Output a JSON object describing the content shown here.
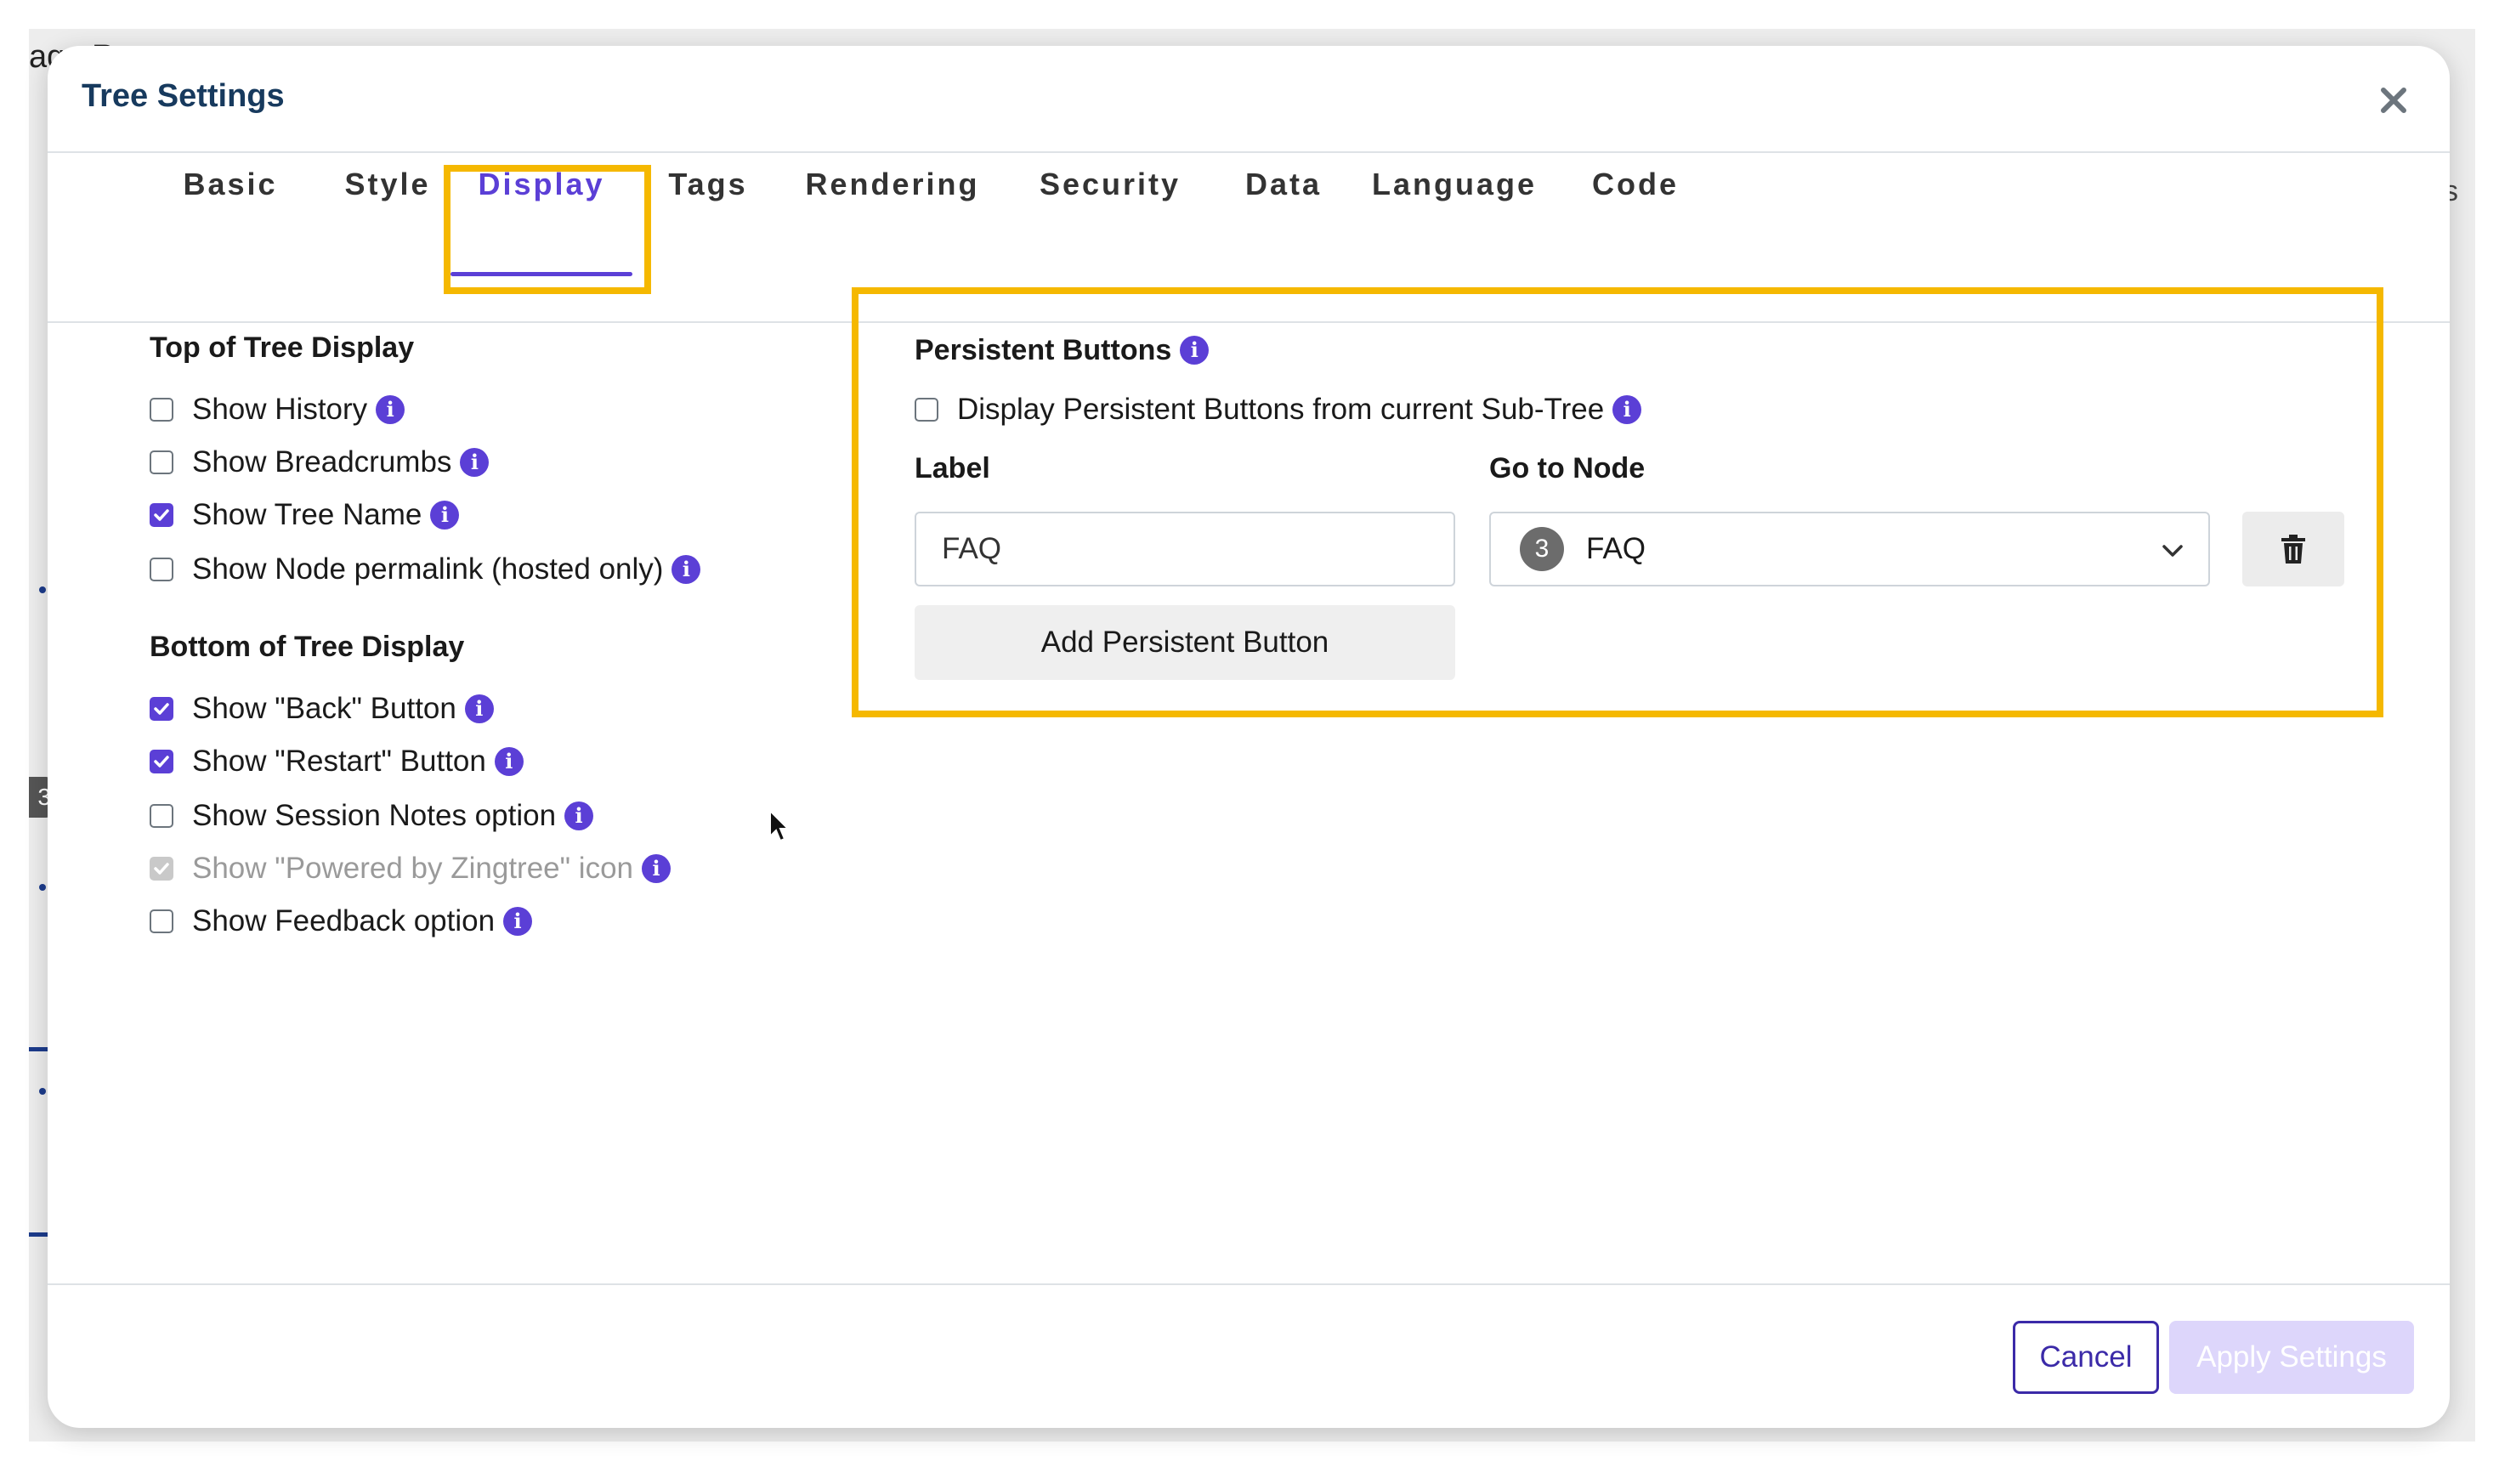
{
  "background": {
    "title": "age Reports",
    "edge_text": "s",
    "badge": "3"
  },
  "modal": {
    "title": "Tree Settings",
    "close_label": "×"
  },
  "tabs": [
    {
      "label": "Basic"
    },
    {
      "label": "Style"
    },
    {
      "label": "Display"
    },
    {
      "label": "Tags"
    },
    {
      "label": "Rendering"
    },
    {
      "label": "Security"
    },
    {
      "label": "Data"
    },
    {
      "label": "Language"
    },
    {
      "label": "Code"
    }
  ],
  "active_tab": "Display",
  "top_display": {
    "title": "Top of Tree Display",
    "options": [
      {
        "label": "Show History",
        "checked": false
      },
      {
        "label": "Show Breadcrumbs",
        "checked": false
      },
      {
        "label": "Show Tree Name",
        "checked": true
      },
      {
        "label": "Show Node permalink (hosted only)",
        "checked": false
      }
    ]
  },
  "bottom_display": {
    "title": "Bottom of Tree Display",
    "options": [
      {
        "label": "Show \"Back\" Button",
        "checked": true
      },
      {
        "label": "Show \"Restart\" Button",
        "checked": true
      },
      {
        "label": "Show Session Notes option",
        "checked": false
      },
      {
        "label": "Show \"Powered by Zingtree\" icon",
        "checked": true,
        "disabled": true
      },
      {
        "label": "Show Feedback option",
        "checked": false
      }
    ]
  },
  "persistent": {
    "title": "Persistent Buttons",
    "subtree_option": "Display Persistent Buttons from current Sub-Tree",
    "subtree_checked": false,
    "label_header": "Label",
    "node_header": "Go to Node",
    "label_value": "FAQ",
    "node_number": "3",
    "node_value": "FAQ",
    "add_button": "Add Persistent Button"
  },
  "footer": {
    "cancel": "Cancel",
    "apply": "Apply Settings"
  },
  "info_glyph": "i",
  "colors": {
    "accent": "#5b3fd6",
    "highlight": "#f5b800",
    "title": "#173a5e",
    "apply_disabled": "#ddd6fb"
  }
}
